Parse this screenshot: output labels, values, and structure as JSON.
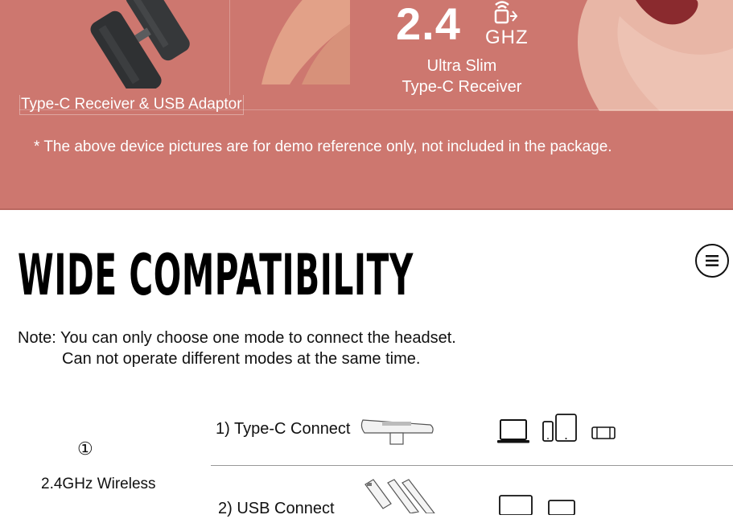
{
  "banner": {
    "background_color": "#cd776f",
    "frequency_value": "2.4",
    "frequency_unit": "GHZ",
    "slim_line1": "Ultra Slim",
    "slim_line2": "Type-C Receiver",
    "receiver_caption": "Type-C Receiver & USB Adaptor",
    "demo_note": "* The above device pictures are for demo reference only, not included in the package."
  },
  "compatibility": {
    "title": "WIDE COMPATIBILITY",
    "note_line1": "Note: You can only choose one mode to connect the headset.",
    "note_line2": "Can not operate different modes at the same time.",
    "mode": {
      "number": "①",
      "name": "2.4GHz Wireless"
    },
    "connections": [
      {
        "label": "1) Type-C Connect",
        "devices": [
          "laptop-icon",
          "phone-icon",
          "tablet-icon",
          "game-console-icon"
        ]
      },
      {
        "label": "2) USB Connect",
        "devices": [
          "laptop-icon",
          "tablet-icon"
        ]
      }
    ]
  },
  "menu_button": {
    "icon": "hamburger-menu-icon"
  }
}
